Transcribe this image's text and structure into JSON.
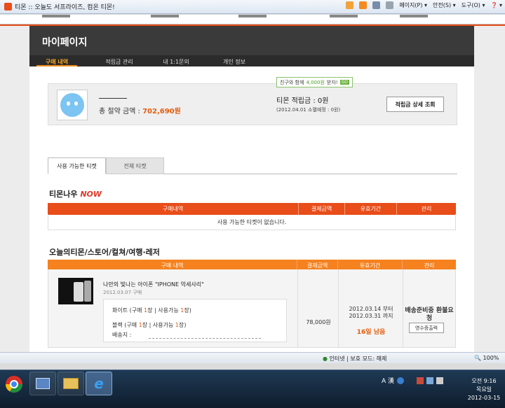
{
  "browser": {
    "tab_title": "티몬 :: 오늘도 서프라이즈, 컴온 티몬!",
    "tools": [
      "페이지(P) ▾",
      "안전(S) ▾",
      "도구(O) ▾",
      "❓ ▾"
    ]
  },
  "mypage": {
    "title": "마이페이지",
    "nav": [
      "구매 내역",
      "적립금 관리",
      "내 1:1문의",
      "개인 정보"
    ]
  },
  "profile": {
    "saving_label": "총 절약 금액 : ",
    "saving_amount": "702,690원",
    "promo_prefix": "친구와 함께 ",
    "promo_amount": "4,000원",
    "promo_suffix": " 받자!",
    "promo_go": "GO",
    "points": "티몬 적립금 : 0원",
    "expire": "(2012.04.01 소멸예정 : 0원)",
    "detail_button": "적립금 상세 조회"
  },
  "tabs": [
    "사용 가능한 티켓",
    "전체 티켓"
  ],
  "now_section": {
    "title_prefix": "티몬나우 ",
    "title_now": "NOW",
    "columns": [
      "구매내역",
      "결제금액",
      "유효기간",
      "관리"
    ],
    "empty": "사용 가능한 티켓이 없습니다."
  },
  "deal_section": {
    "title": "오늘의티몬/스토어/컬쳐/여행·레저",
    "columns": [
      "구매 내역",
      "결제금액",
      "유효기간",
      "관리"
    ],
    "order": {
      "product": "나만의 빛나는 아이폰 \"IPHONE 악세사리\"",
      "date": "2012.03.07 구매",
      "opt1_prefix": "화이트 (구매 ",
      "opt1_qty": "1",
      "opt1_mid": "장 | 사용가능 ",
      "opt1_use": "1",
      "opt1_suffix": "장)",
      "opt2_prefix": "블랙 (구매 ",
      "opt2_qty": "1",
      "opt2_mid": "장 | 사용가능 ",
      "opt2_use": "1",
      "opt2_suffix": "장)",
      "address_label": "배송지 :",
      "price": "78,000원",
      "valid_from": "2012.03.14 부터",
      "valid_to": "2012.03.31 까지",
      "remain": "16일 남음",
      "ship_status": "배송준비중 환불요청",
      "receipt_button": "영수증출력"
    }
  },
  "statusbar": {
    "zone": "인터넷 | 보호 모드: 해제",
    "zoom": "100%"
  },
  "taskbar": {
    "time": "오전 9:16",
    "day": "목요일",
    "date": "2012-03-15",
    "ime": "A 漢"
  }
}
